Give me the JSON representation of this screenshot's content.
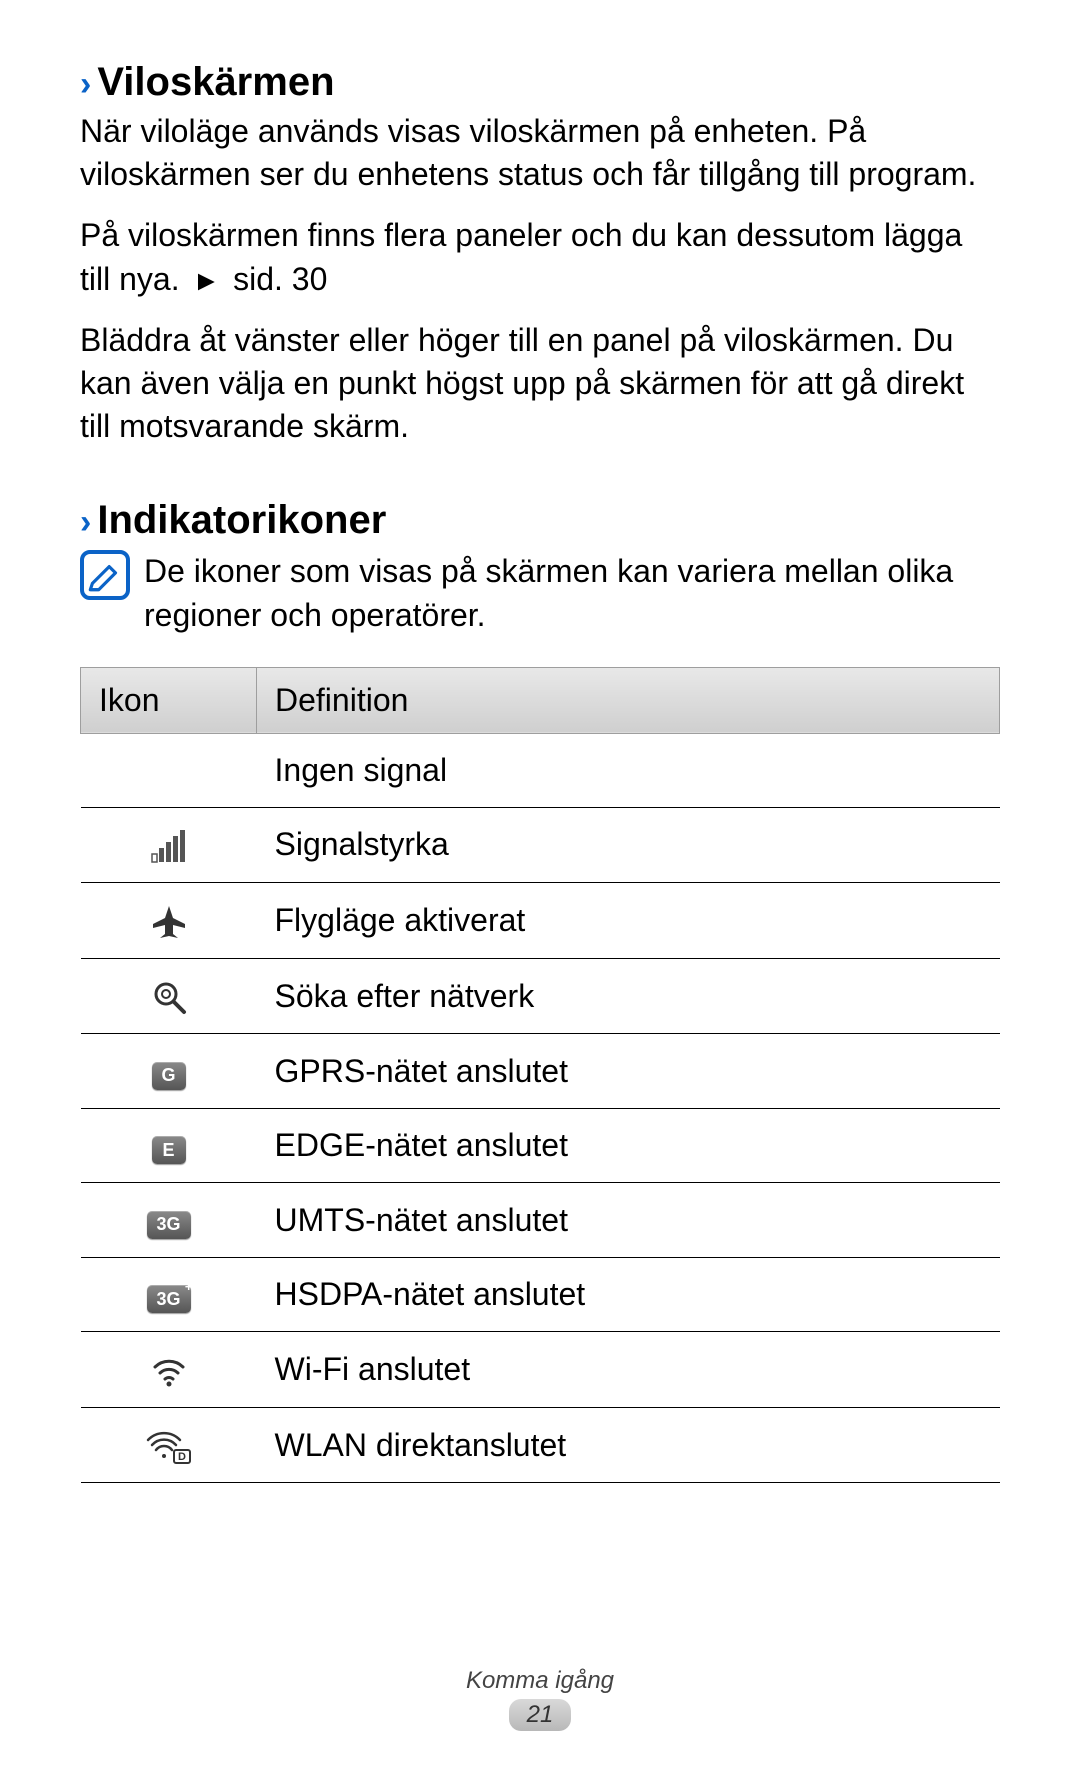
{
  "section1": {
    "heading": "Viloskärmen",
    "p1": "När viloläge används visas viloskärmen på enheten. På viloskärmen ser du enhetens status och får tillgång till program.",
    "p2a": "På viloskärmen finns flera paneler och du kan dessutom lägga till nya. ",
    "p2b": " sid. 30",
    "p3": "Bläddra åt vänster eller höger till en panel på viloskärmen. Du kan även välja en punkt högst upp på skärmen för att gå direkt till motsvarande skärm."
  },
  "section2": {
    "heading": "Indikatorikoner",
    "note": "De ikoner som visas på skärmen kan variera mellan olika regioner och operatörer."
  },
  "table": {
    "header_icon": "Ikon",
    "header_def": "Definition",
    "rows": [
      {
        "icon": "none",
        "def": "Ingen signal"
      },
      {
        "icon": "signal",
        "def": "Signalstyrka"
      },
      {
        "icon": "plane",
        "def": "Flygläge aktiverat"
      },
      {
        "icon": "search",
        "def": "Söka efter nätverk"
      },
      {
        "icon": "G",
        "def": "GPRS-nätet anslutet"
      },
      {
        "icon": "E",
        "def": "EDGE-nätet anslutet"
      },
      {
        "icon": "3G",
        "def": "UMTS-nätet anslutet"
      },
      {
        "icon": "3G+",
        "def": "HSDPA-nätet anslutet"
      },
      {
        "icon": "wifi",
        "def": "Wi-Fi anslutet"
      },
      {
        "icon": "wifid",
        "def": "WLAN direktanslutet"
      }
    ]
  },
  "footer": {
    "chapter": "Komma igång",
    "page": "21"
  }
}
